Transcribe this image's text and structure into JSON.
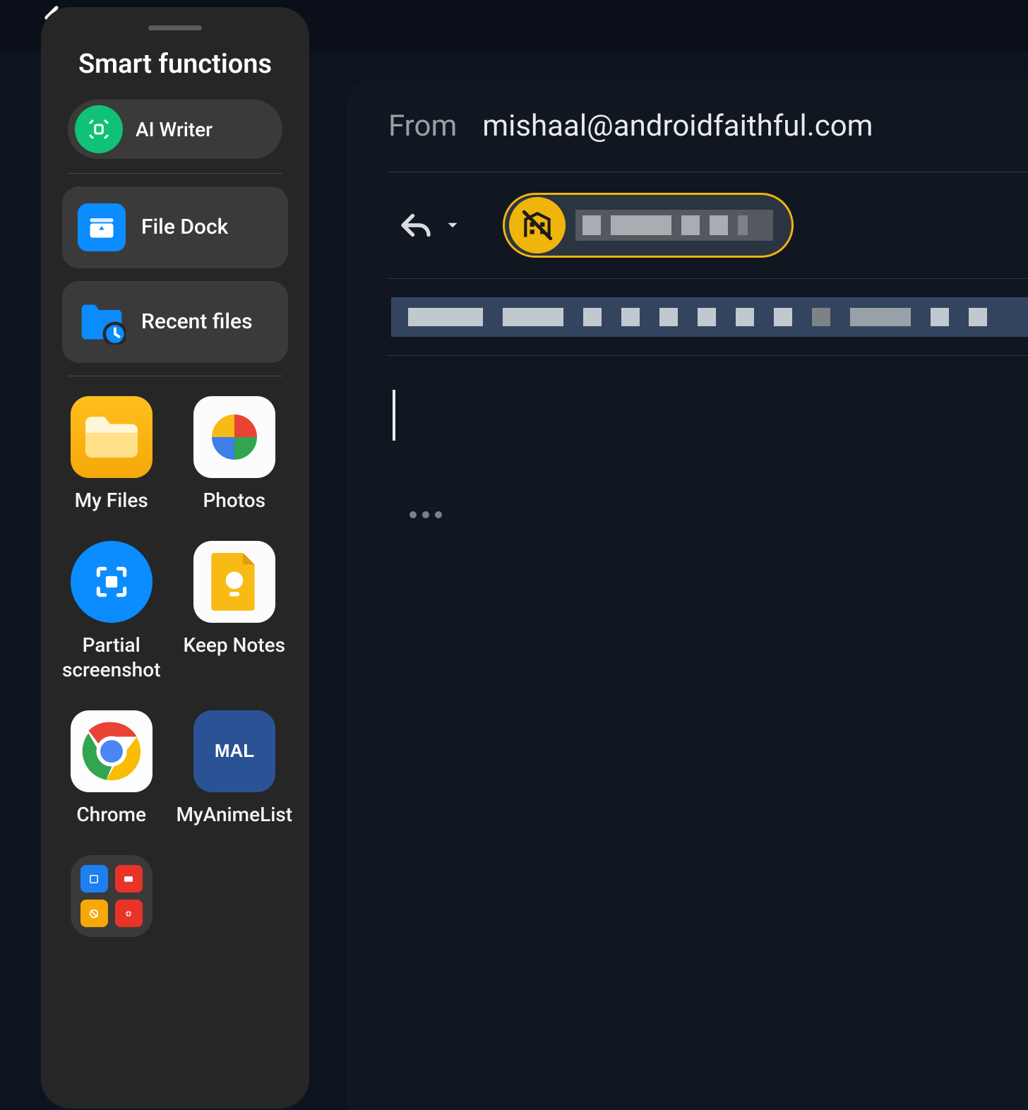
{
  "panel": {
    "title": "Smart functions",
    "ai_writer_label": "AI Writer",
    "file_dock_label": "File Dock",
    "recent_files_label": "Recent files",
    "apps": [
      {
        "label": "My Files"
      },
      {
        "label": "Photos"
      },
      {
        "label": "Partial screenshot"
      },
      {
        "label": "Keep Notes"
      },
      {
        "label": "Chrome"
      },
      {
        "label": "MyAnimeList"
      }
    ]
  },
  "compose": {
    "from_label": "From",
    "from_email": "mishaal@androidfaithful.com"
  }
}
